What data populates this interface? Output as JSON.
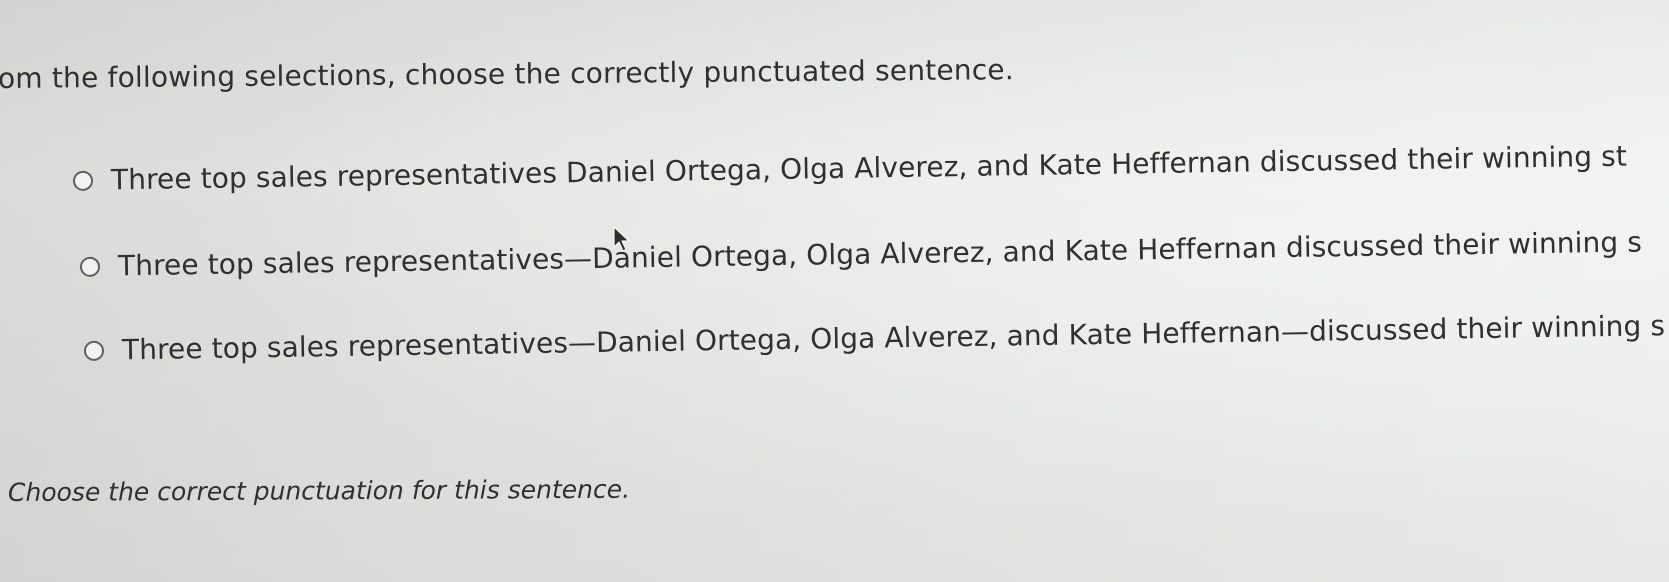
{
  "question": {
    "text": "om the following selections, choose the correctly punctuated sentence."
  },
  "options": [
    {
      "label": "Three top sales representatives Daniel Ortega, Olga Alverez, and Kate Heffernan discussed their winning st",
      "selected": false
    },
    {
      "label": "Three top sales representatives—Daniel Ortega, Olga Alverez, and Kate Heffernan discussed their winning s",
      "selected": false
    },
    {
      "label": "Three top sales representatives—Daniel Ortega, Olga Alverez, and Kate Heffernan—discussed their winning s",
      "selected": false
    }
  ],
  "instruction": {
    "text": "Choose the correct punctuation for this sentence."
  },
  "icons": {
    "pointer": "mouse-pointer-icon",
    "radio": "radio-button-icon"
  },
  "colors": {
    "text": "#2e3031",
    "radio_border": "#5c6066",
    "background": "#e6e8e5"
  }
}
